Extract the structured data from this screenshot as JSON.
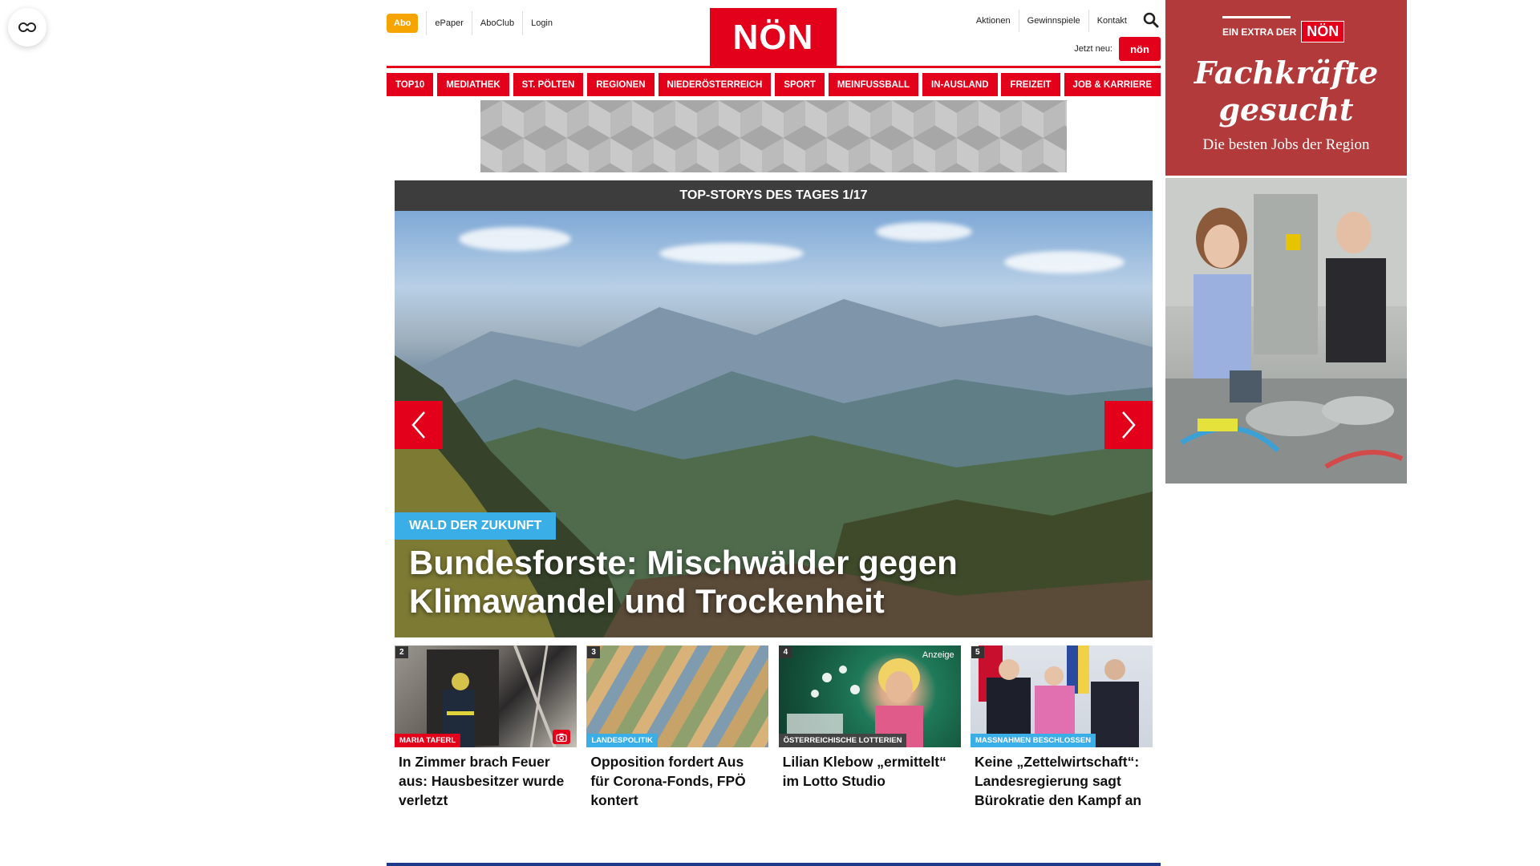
{
  "header": {
    "abo": "Abo",
    "top_links_left": [
      "ePaper",
      "AboClub",
      "Login"
    ],
    "logo": "NÖN",
    "top_links_right": [
      "Aktionen",
      "Gewinnspiele",
      "Kontakt"
    ],
    "jetzt_neu": "Jetzt neu:",
    "jetzt_logo": "nön"
  },
  "nav": [
    "TOP10",
    "MEDIATHEK",
    "ST. PÖLTEN",
    "REGIONEN",
    "NIEDERÖSTERREICH",
    "SPORT",
    "MEINFUSSBALL",
    "IN-AUSLAND",
    "FREIZEIT",
    "JOB & KARRIERE"
  ],
  "slider": {
    "heading": "TOP-STORYS DES TAGES 1/17",
    "kicker": "WALD DER ZUKUNFT",
    "headline": "Bundesforste: Mischwälder gegen Klimawandel und Trockenheit"
  },
  "cards": [
    {
      "num": "2",
      "tag": "MARIA TAFERL",
      "title": "In Zimmer brach Feuer aus: Hausbesitzer wurde verletzt"
    },
    {
      "num": "3",
      "tag": "LANDESPOLITIK",
      "title": "Opposition fordert Aus für Corona-Fonds, FPÖ kontert"
    },
    {
      "num": "4",
      "tag": "ÖSTERREICHISCHE LOTTERIEN",
      "badge": "Anzeige",
      "title": "Lilian Klebow „ermittelt“ im Lotto Studio"
    },
    {
      "num": "5",
      "tag": "MASSNAHMEN BESCHLOSSEN",
      "title": "Keine „Zettelwirtschaft“: Landesregierung sagt Bürokratie den Kampf an"
    }
  ],
  "ad": {
    "brand_prefix": "EIN EXTRA DER",
    "brand_logo": "NÖN",
    "headline_1": "Fachkräfte",
    "headline_2": "gesucht",
    "sub": "Die besten Jobs der Region"
  },
  "colors": {
    "brand_red": "#e2001a",
    "abo_orange": "#f5a400",
    "kicker_blue": "#3aaee6",
    "ad_red": "#b23a3a",
    "footer_blue": "#1d3a8a"
  },
  "icons": {
    "reader": "reader-mode-icon",
    "search": "search-icon",
    "prev": "chevron-left-icon",
    "next": "chevron-right-icon",
    "camera": "camera-icon"
  }
}
